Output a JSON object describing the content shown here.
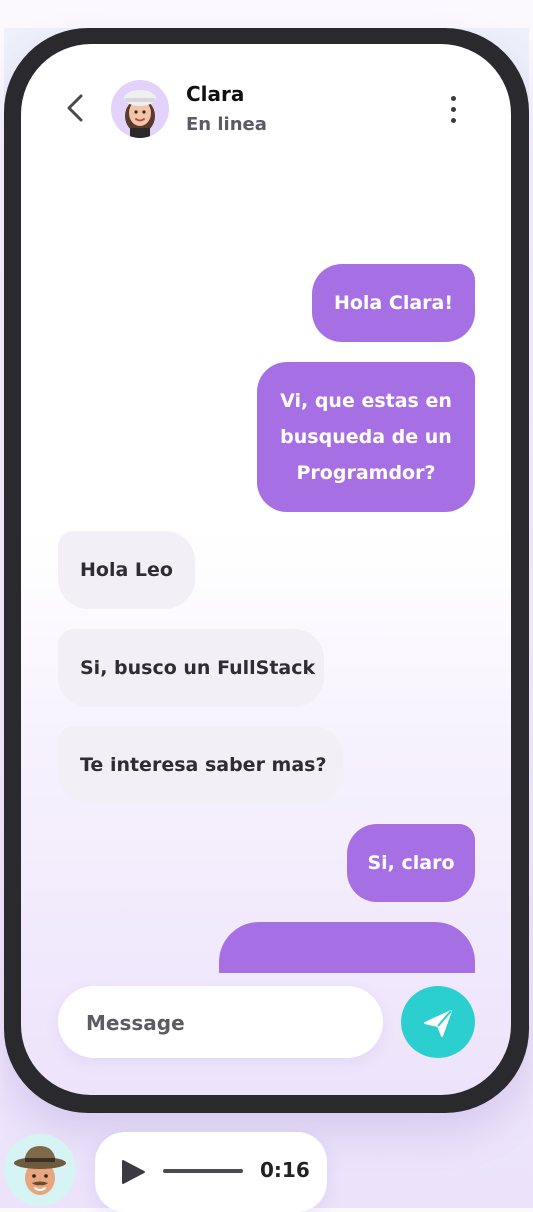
{
  "header": {
    "contact_name": "Clara",
    "contact_status": "En linea"
  },
  "messages": [
    {
      "direction": "outgoing",
      "text": "Hola Clara!"
    },
    {
      "direction": "outgoing",
      "text": "Vi, que estas en busqueda de un Programdor?"
    },
    {
      "direction": "incoming",
      "text": "Hola Leo"
    },
    {
      "direction": "incoming",
      "text": "Si, busco un FullStack"
    },
    {
      "direction": "incoming",
      "text": "Te interesa saber mas?"
    },
    {
      "direction": "outgoing",
      "text": "Si, claro"
    }
  ],
  "composer": {
    "placeholder": "Message",
    "send_icon": "paper-plane-icon"
  },
  "voice_note": {
    "duration": "0:16",
    "play_icon": "play-icon"
  },
  "icons": {
    "back": "chevron-left-icon",
    "menu": "kebab-menu-icon"
  },
  "colors": {
    "outgoing_bubble": "#a66fe3",
    "incoming_bubble": "#f2eff6",
    "send_button": "#2ccfcf",
    "phone_frame": "#2a292d"
  }
}
